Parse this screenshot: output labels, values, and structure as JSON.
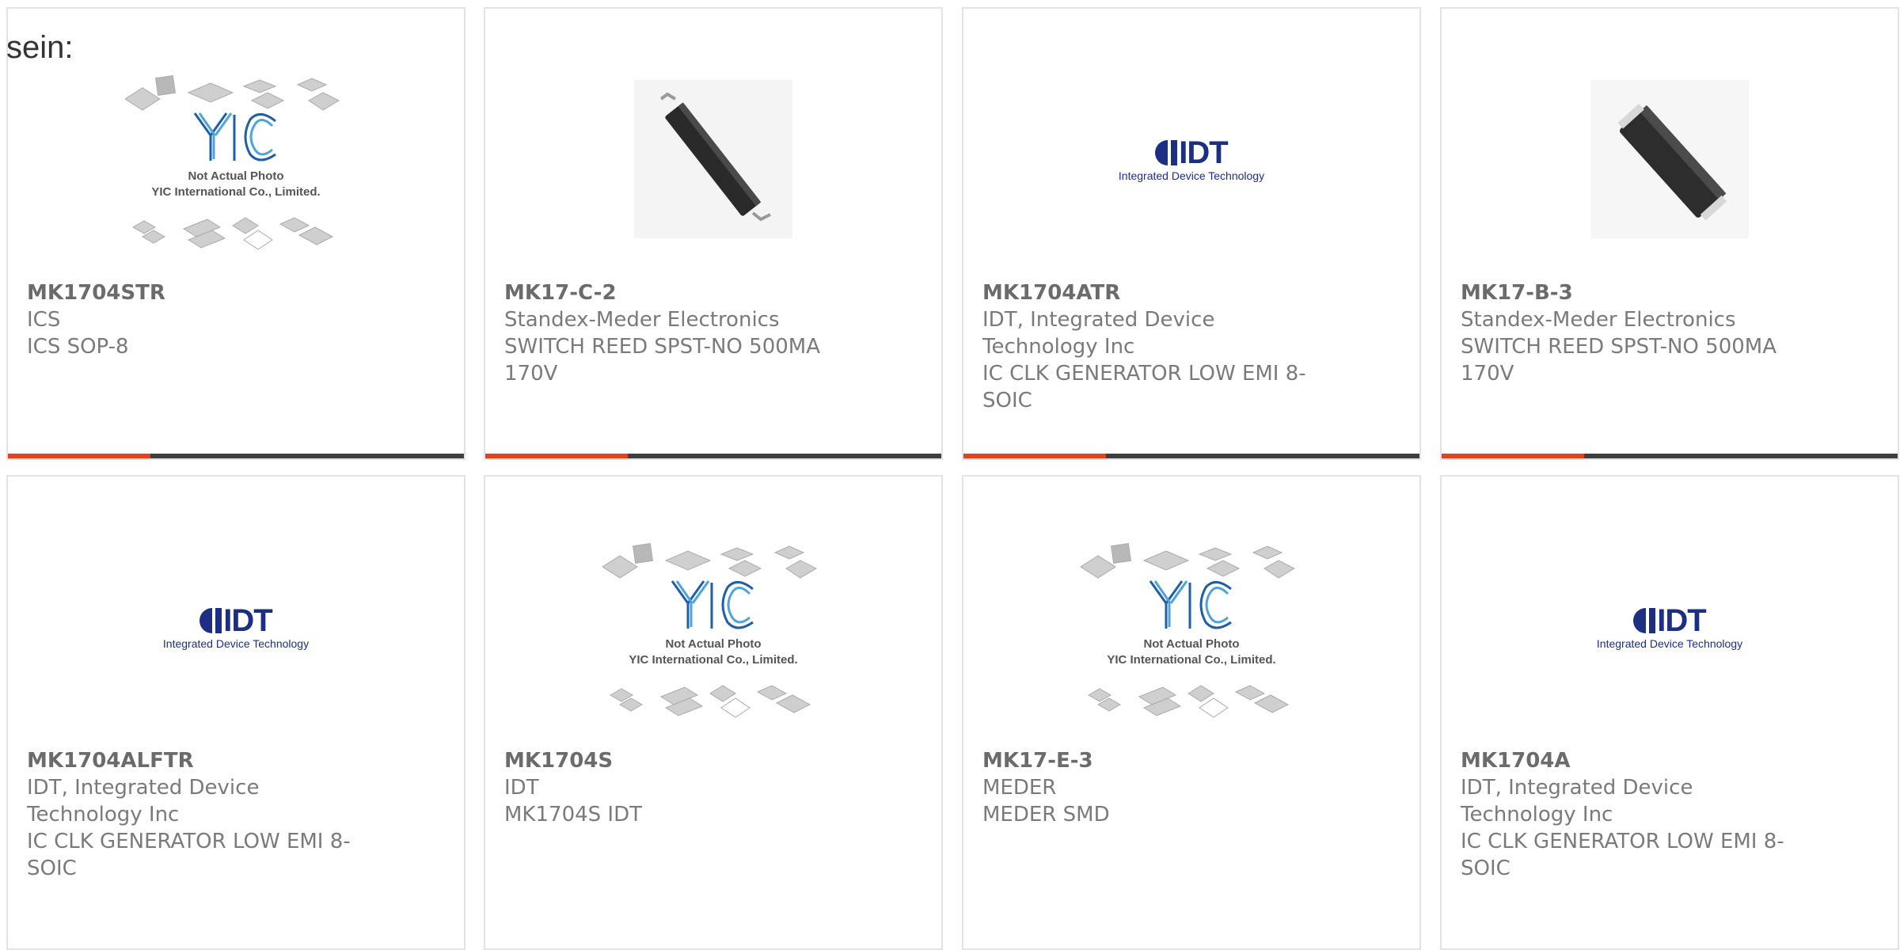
{
  "heading": "sein:",
  "accent_color": "#e8401c",
  "bar_color": "#3e3e3e",
  "placeholder": {
    "line1": "Not Actual Photo",
    "line2": "YIC International Co., Limited."
  },
  "idt_logo": {
    "name": "IDT",
    "tagline": "Integrated Device Technology"
  },
  "products": [
    {
      "part": "MK1704STR",
      "manufacturer": "ICS",
      "description": "ICS SOP-8",
      "image": "yic-placeholder"
    },
    {
      "part": "MK17-C-2",
      "manufacturer": "Standex-Meder Electronics",
      "description": "SWITCH REED SPST-NO 500MA 170V",
      "image": "reed-switch-tilted"
    },
    {
      "part": "MK1704ATR",
      "manufacturer": "IDT, Integrated Device Technology Inc",
      "description": "IC CLK GENERATOR LOW EMI 8-SOIC",
      "image": "idt-logo"
    },
    {
      "part": "MK17-B-3",
      "manufacturer": "Standex-Meder Electronics",
      "description": "SWITCH REED SPST-NO 500MA 170V",
      "image": "reed-switch-block"
    },
    {
      "part": "MK1704ALFTR",
      "manufacturer": "IDT, Integrated Device Technology Inc",
      "description": "IC CLK GENERATOR LOW EMI 8-SOIC",
      "image": "idt-logo"
    },
    {
      "part": "MK1704S",
      "manufacturer": "IDT",
      "description": "MK1704S IDT",
      "image": "yic-placeholder"
    },
    {
      "part": "MK17-E-3",
      "manufacturer": "MEDER",
      "description": "MEDER SMD",
      "image": "yic-placeholder"
    },
    {
      "part": "MK1704A",
      "manufacturer": "IDT, Integrated Device Technology Inc",
      "description": "IC CLK GENERATOR LOW EMI 8-SOIC",
      "image": "idt-logo"
    }
  ]
}
